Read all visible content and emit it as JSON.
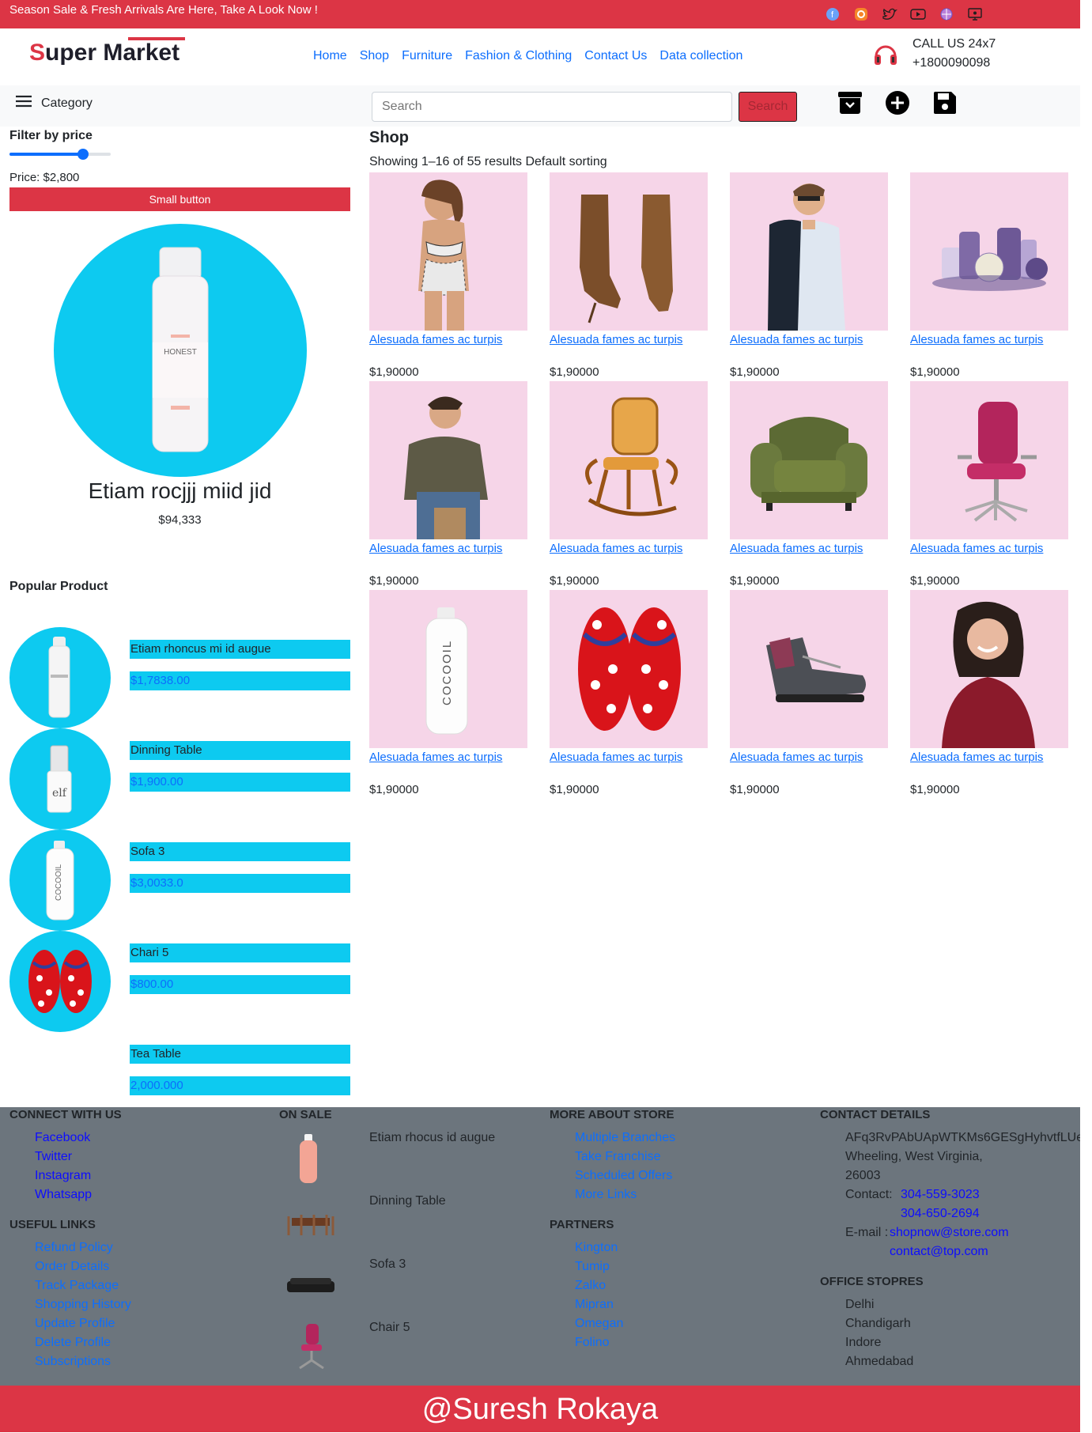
{
  "topbar": {
    "message": "Season Sale & Fresh Arrivals Are Here, Take A Look Now !",
    "social_icons": [
      "facebook-icon",
      "instagram-icon",
      "twitter-icon",
      "youtube-icon",
      "web-icon",
      "monitor-icon"
    ]
  },
  "header": {
    "logo_first": "S",
    "logo_rest": "uper Market",
    "nav": [
      "Home",
      "Shop",
      "Furniture",
      "Fashion & Clothing",
      "Contact Us",
      "Data collection"
    ],
    "call_label": "CALL US 24x7",
    "call_number": "+1800090098"
  },
  "subbar": {
    "category_label": "Category",
    "search_placeholder": "Search",
    "search_button": "Search"
  },
  "sidebar": {
    "filter_title": "Filter by price",
    "price_text": "Price: $2,800",
    "price_slider_fraction": 0.75,
    "small_button": "Small button",
    "featured_name": "Etiam rocjjj miid jid",
    "featured_price": "$94,333",
    "featured_brand": "HONEST",
    "popular_title": "Popular Product",
    "popular": [
      {
        "name": "Etiam rhoncus mi id augue",
        "price": "$1,7838.00",
        "img": "bottle"
      },
      {
        "name": "Dinning Table",
        "price": "$1,900.00",
        "img": "elf"
      },
      {
        "name": "Sofa 3",
        "price": "$3,0033.0",
        "img": "cocooil"
      },
      {
        "name": "Chari 5",
        "price": "$800.00",
        "img": "flipflop"
      },
      {
        "name": "Tea Table",
        "price": "2,000.000",
        "img": ""
      }
    ]
  },
  "shop": {
    "title": "Shop",
    "showing": "Showing 1–16 of 55 results Default sorting",
    "products": [
      {
        "name": "Alesuada fames ac turpis",
        "price": "$1,90000",
        "img": "woman-swimsuit"
      },
      {
        "name": "Alesuada fames ac turpis",
        "price": "$1,90000",
        "img": "boots"
      },
      {
        "name": "Alesuada fames ac turpis",
        "price": "$1,90000",
        "img": "man-shirt"
      },
      {
        "name": "Alesuada fames ac turpis",
        "price": "$1,90000",
        "img": "cosmetics"
      },
      {
        "name": "Alesuada fames ac turpis",
        "price": "$1,90000",
        "img": "man-jacket"
      },
      {
        "name": "Alesuada fames ac turpis",
        "price": "$1,90000",
        "img": "rocking-chair"
      },
      {
        "name": "Alesuada fames ac turpis",
        "price": "$1,90000",
        "img": "armchair"
      },
      {
        "name": "Alesuada fames ac turpis",
        "price": "$1,90000",
        "img": "office-chair"
      },
      {
        "name": "Alesuada fames ac turpis",
        "price": "$1,90000",
        "img": "cocooil"
      },
      {
        "name": "Alesuada fames ac turpis",
        "price": "$1,90000",
        "img": "flipflop"
      },
      {
        "name": "Alesuada fames ac turpis",
        "price": "$1,90000",
        "img": "hiking-boot"
      },
      {
        "name": "Alesuada fames ac turpis",
        "price": "$1,90000",
        "img": "woman-smile"
      }
    ]
  },
  "footer": {
    "connect_title": "CONNECT WITH US",
    "connect": [
      "Facebook",
      "Twitter",
      "Instagram",
      "Whatsapp"
    ],
    "useful_title": "USEFUL LINKS",
    "useful": [
      "Refund Policy",
      "Order Details",
      "Track Package",
      "Shopping History",
      "Update Profile",
      "Delete Profile",
      "Subscriptions"
    ],
    "sale_title": "ON SALE",
    "sale": [
      "Etiam rhocus id augue",
      "Dinning Table",
      "Sofa 3",
      "Chair 5"
    ],
    "more_title": "MORE ABOUT STORE",
    "more": [
      "Multiple Branches",
      "Take Franchise",
      "Scheduled Offers",
      "More Links"
    ],
    "partners_title": "PARTNERS",
    "partners": [
      "Kington",
      "Tumip",
      "Zalko",
      "Mipran",
      "Omegan",
      "Folino"
    ],
    "contact_title": "CONTACT DETAILS",
    "address1": "AFq3RvPAbUApWTKMs6GESgHyhvtfLUe2Wr",
    "address2": "Wheeling, West Virginia,",
    "address3": "26003",
    "contact_label": "Contact:",
    "phone1": "304-559-3023",
    "phone2": "304-650-2694",
    "email_label": "E-mail :",
    "email1": "shopnow@store.com",
    "email2": "contact@top.com",
    "offices_title": "OFFICE STOPRES",
    "offices": [
      "Delhi",
      "Chandigarh",
      "Indore",
      "Ahmedabad"
    ]
  },
  "copyright": "@Suresh Rokaya"
}
